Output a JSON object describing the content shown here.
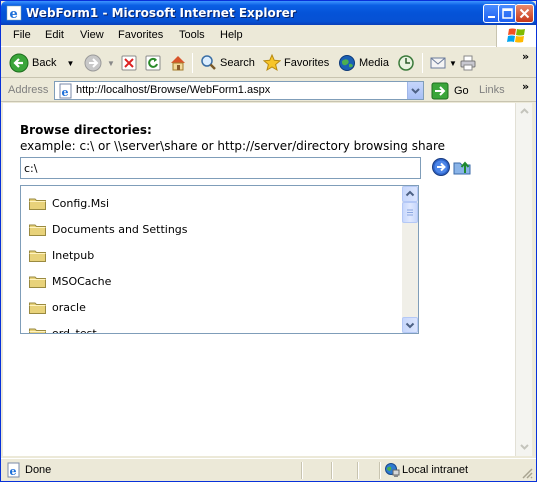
{
  "window": {
    "title": "WebForm1 - Microsoft Internet Explorer",
    "controls": [
      "minimize",
      "maximize",
      "close"
    ]
  },
  "menu": [
    {
      "label": "File",
      "key": "F"
    },
    {
      "label": "Edit",
      "key": "E"
    },
    {
      "label": "View",
      "key": "V"
    },
    {
      "label": "Favorites",
      "key": "a"
    },
    {
      "label": "Tools",
      "key": "T"
    },
    {
      "label": "Help",
      "key": "H"
    }
  ],
  "toolbar": {
    "back_label": "Back",
    "search_label": "Search",
    "favorites_label": "Favorites",
    "media_label": "Media",
    "chevron": "»"
  },
  "address": {
    "label": "Address",
    "url": "http://localhost/Browse/WebForm1.aspx",
    "go_label": "Go",
    "links_label": "Links",
    "chevron": "»"
  },
  "page": {
    "heading": "Browse directories:",
    "example": "example: c:\\ or \\\\server\\share or http://server/directory browsing share",
    "path_value": "c:\\",
    "directories": [
      "Config.Msi",
      "Documents and Settings",
      "Inetpub",
      "MSOCache",
      "oracle",
      "ord_test"
    ]
  },
  "statusbar": {
    "status": "Done",
    "zone": "Local intranet"
  },
  "colors": {
    "titlebar": "#0553d8",
    "chrome": "#ece9d8",
    "field_border": "#7f9db9",
    "folder": "#e8d27a"
  }
}
